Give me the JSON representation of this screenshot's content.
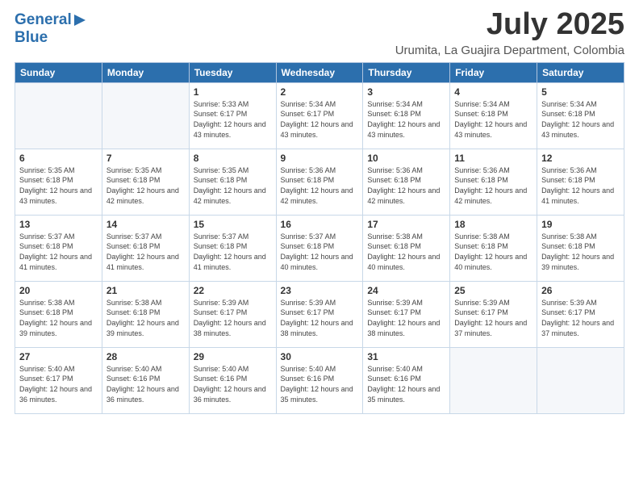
{
  "header": {
    "logo_general": "General",
    "logo_blue": "Blue",
    "title": "July 2025",
    "subtitle": "Urumita, La Guajira Department, Colombia"
  },
  "days_header": [
    "Sunday",
    "Monday",
    "Tuesday",
    "Wednesday",
    "Thursday",
    "Friday",
    "Saturday"
  ],
  "weeks": [
    [
      {
        "day": "",
        "info": ""
      },
      {
        "day": "",
        "info": ""
      },
      {
        "day": "1",
        "info": "Sunrise: 5:33 AM\nSunset: 6:17 PM\nDaylight: 12 hours and 43 minutes."
      },
      {
        "day": "2",
        "info": "Sunrise: 5:34 AM\nSunset: 6:17 PM\nDaylight: 12 hours and 43 minutes."
      },
      {
        "day": "3",
        "info": "Sunrise: 5:34 AM\nSunset: 6:18 PM\nDaylight: 12 hours and 43 minutes."
      },
      {
        "day": "4",
        "info": "Sunrise: 5:34 AM\nSunset: 6:18 PM\nDaylight: 12 hours and 43 minutes."
      },
      {
        "day": "5",
        "info": "Sunrise: 5:34 AM\nSunset: 6:18 PM\nDaylight: 12 hours and 43 minutes."
      }
    ],
    [
      {
        "day": "6",
        "info": "Sunrise: 5:35 AM\nSunset: 6:18 PM\nDaylight: 12 hours and 43 minutes."
      },
      {
        "day": "7",
        "info": "Sunrise: 5:35 AM\nSunset: 6:18 PM\nDaylight: 12 hours and 42 minutes."
      },
      {
        "day": "8",
        "info": "Sunrise: 5:35 AM\nSunset: 6:18 PM\nDaylight: 12 hours and 42 minutes."
      },
      {
        "day": "9",
        "info": "Sunrise: 5:36 AM\nSunset: 6:18 PM\nDaylight: 12 hours and 42 minutes."
      },
      {
        "day": "10",
        "info": "Sunrise: 5:36 AM\nSunset: 6:18 PM\nDaylight: 12 hours and 42 minutes."
      },
      {
        "day": "11",
        "info": "Sunrise: 5:36 AM\nSunset: 6:18 PM\nDaylight: 12 hours and 42 minutes."
      },
      {
        "day": "12",
        "info": "Sunrise: 5:36 AM\nSunset: 6:18 PM\nDaylight: 12 hours and 41 minutes."
      }
    ],
    [
      {
        "day": "13",
        "info": "Sunrise: 5:37 AM\nSunset: 6:18 PM\nDaylight: 12 hours and 41 minutes."
      },
      {
        "day": "14",
        "info": "Sunrise: 5:37 AM\nSunset: 6:18 PM\nDaylight: 12 hours and 41 minutes."
      },
      {
        "day": "15",
        "info": "Sunrise: 5:37 AM\nSunset: 6:18 PM\nDaylight: 12 hours and 41 minutes."
      },
      {
        "day": "16",
        "info": "Sunrise: 5:37 AM\nSunset: 6:18 PM\nDaylight: 12 hours and 40 minutes."
      },
      {
        "day": "17",
        "info": "Sunrise: 5:38 AM\nSunset: 6:18 PM\nDaylight: 12 hours and 40 minutes."
      },
      {
        "day": "18",
        "info": "Sunrise: 5:38 AM\nSunset: 6:18 PM\nDaylight: 12 hours and 40 minutes."
      },
      {
        "day": "19",
        "info": "Sunrise: 5:38 AM\nSunset: 6:18 PM\nDaylight: 12 hours and 39 minutes."
      }
    ],
    [
      {
        "day": "20",
        "info": "Sunrise: 5:38 AM\nSunset: 6:18 PM\nDaylight: 12 hours and 39 minutes."
      },
      {
        "day": "21",
        "info": "Sunrise: 5:38 AM\nSunset: 6:18 PM\nDaylight: 12 hours and 39 minutes."
      },
      {
        "day": "22",
        "info": "Sunrise: 5:39 AM\nSunset: 6:17 PM\nDaylight: 12 hours and 38 minutes."
      },
      {
        "day": "23",
        "info": "Sunrise: 5:39 AM\nSunset: 6:17 PM\nDaylight: 12 hours and 38 minutes."
      },
      {
        "day": "24",
        "info": "Sunrise: 5:39 AM\nSunset: 6:17 PM\nDaylight: 12 hours and 38 minutes."
      },
      {
        "day": "25",
        "info": "Sunrise: 5:39 AM\nSunset: 6:17 PM\nDaylight: 12 hours and 37 minutes."
      },
      {
        "day": "26",
        "info": "Sunrise: 5:39 AM\nSunset: 6:17 PM\nDaylight: 12 hours and 37 minutes."
      }
    ],
    [
      {
        "day": "27",
        "info": "Sunrise: 5:40 AM\nSunset: 6:17 PM\nDaylight: 12 hours and 36 minutes."
      },
      {
        "day": "28",
        "info": "Sunrise: 5:40 AM\nSunset: 6:16 PM\nDaylight: 12 hours and 36 minutes."
      },
      {
        "day": "29",
        "info": "Sunrise: 5:40 AM\nSunset: 6:16 PM\nDaylight: 12 hours and 36 minutes."
      },
      {
        "day": "30",
        "info": "Sunrise: 5:40 AM\nSunset: 6:16 PM\nDaylight: 12 hours and 35 minutes."
      },
      {
        "day": "31",
        "info": "Sunrise: 5:40 AM\nSunset: 6:16 PM\nDaylight: 12 hours and 35 minutes."
      },
      {
        "day": "",
        "info": ""
      },
      {
        "day": "",
        "info": ""
      }
    ]
  ]
}
